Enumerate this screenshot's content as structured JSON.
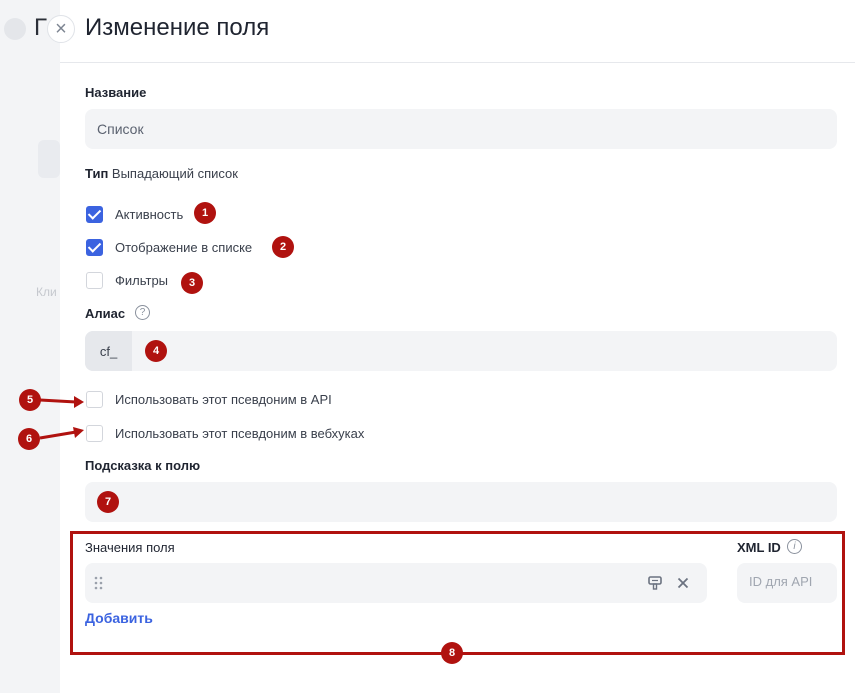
{
  "background": {
    "partial_title": "Г"
  },
  "header": {
    "title": "Изменение поля"
  },
  "form": {
    "name": {
      "label": "Название",
      "value": "Список"
    },
    "type": {
      "label": "Тип",
      "value": "Выпадающий список"
    },
    "checkboxes": [
      {
        "label": "Активность",
        "checked": true,
        "badge": "1"
      },
      {
        "label": "Отображение в списке",
        "checked": true,
        "badge": "2"
      },
      {
        "label": "Фильтры",
        "checked": false,
        "badge": "3"
      }
    ],
    "alias": {
      "label": "Алиас",
      "prefix": "cf_",
      "badge": "4"
    },
    "alias_options": [
      {
        "label": "Использовать этот псевдоним в API",
        "checked": false,
        "badge": "5"
      },
      {
        "label": "Использовать этот псевдоним в вебхуках",
        "checked": false,
        "badge": "6"
      }
    ],
    "hint": {
      "label": "Подсказка к полю",
      "value": "",
      "badge": "7"
    },
    "values": {
      "label": "Значения поля",
      "xml_label": "XML ID",
      "xml_placeholder": "ID для API",
      "add_label": "Добавить",
      "badge": "8"
    }
  },
  "colors": {
    "accent": "#3b63e0",
    "annotation": "#b0120f"
  }
}
